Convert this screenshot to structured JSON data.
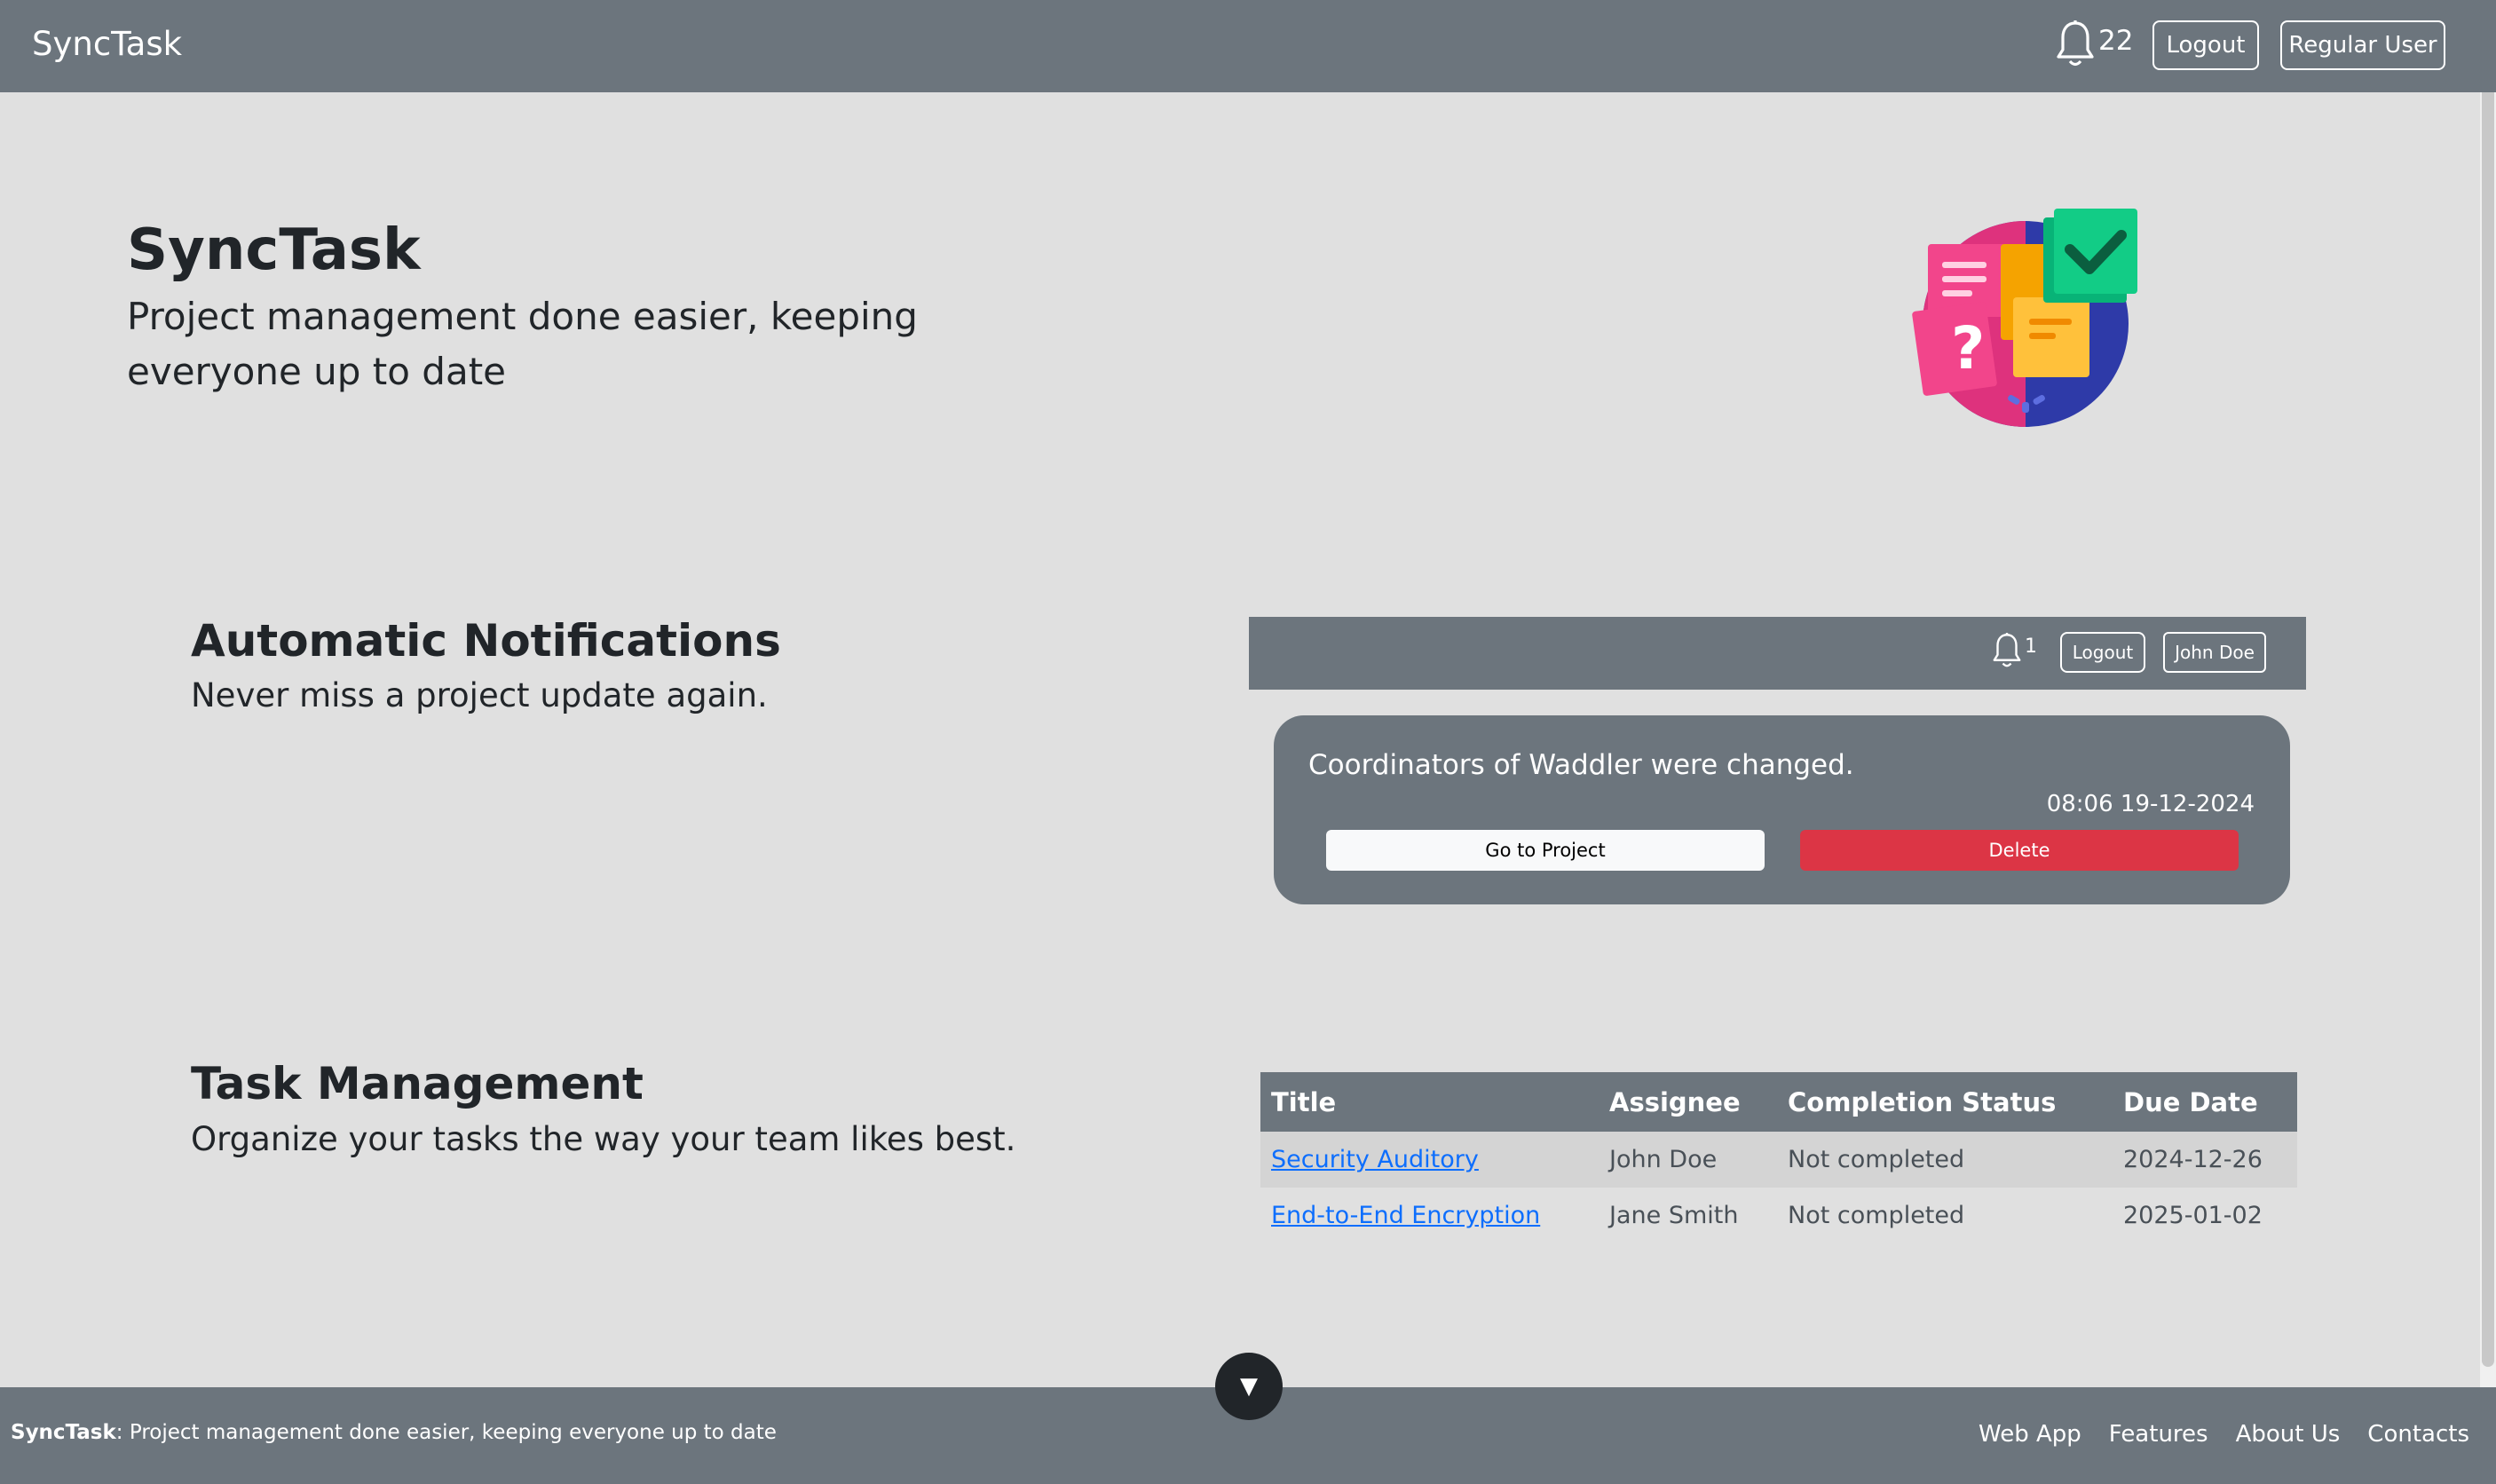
{
  "navbar": {
    "brand": "SyncTask",
    "notification_count": "22",
    "logout_label": "Logout",
    "user_label": "Regular User"
  },
  "hero": {
    "title": "SyncTask",
    "subtitle": "Project management done easier, keeping everyone up to date",
    "logo_icon": "sticky-notes-checkmark-icon"
  },
  "notifications_section": {
    "title": "Automatic Notifications",
    "subtitle": "Never miss a project update again.",
    "mock_navbar": {
      "notification_count": "1",
      "logout_label": "Logout",
      "user_label": "John Doe"
    },
    "card": {
      "message": "Coordinators of Waddler were changed.",
      "time": "08:06 19-12-2024",
      "go_label": "Go to Project",
      "delete_label": "Delete"
    }
  },
  "tasks_section": {
    "title": "Task Management",
    "subtitle": "Organize your tasks the way your team likes best.",
    "table": {
      "headers": [
        "Title",
        "Assignee",
        "Completion Status",
        "Due Date"
      ],
      "rows": [
        {
          "title": "Security Auditory",
          "assignee": "John Doe",
          "status": "Not completed",
          "due": "2024-12-26"
        },
        {
          "title": "End-to-End Encryption",
          "assignee": "Jane Smith",
          "status": "Not completed",
          "due": "2025-01-02"
        }
      ]
    }
  },
  "scroll_toggle": {
    "glyph": "▼"
  },
  "footer": {
    "brand": "SyncTask",
    "tagline": ": Project management done easier, keeping everyone up to date",
    "links": [
      "Web App",
      "Features",
      "About Us",
      "Contacts"
    ]
  },
  "colors": {
    "navbar_bg": "#6c757d",
    "page_bg": "#e0e0e0",
    "danger": "#dc3545",
    "link": "#0d6efd"
  }
}
